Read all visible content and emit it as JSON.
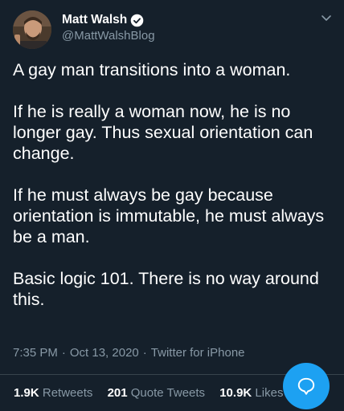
{
  "author": {
    "name": "Matt Walsh",
    "handle": "@MattWalshBlog",
    "verified": true
  },
  "tweet": {
    "paragraphs": [
      "A gay man transitions into a woman.",
      "If he is really a woman now, he is no longer gay. Thus sexual orientation can change.",
      "If he must always be gay because orientation is immutable, he must always be a man.",
      "Basic logic 101. There is no way around this."
    ],
    "time": "7:35 PM",
    "date": "Oct 13, 2020",
    "source": "Twitter for iPhone"
  },
  "stats": {
    "retweets_count": "1.9K",
    "retweets_label": "Retweets",
    "quotes_count": "201",
    "quotes_label": "Quote Tweets",
    "likes_count": "10.9K",
    "likes_label": "Likes"
  },
  "icons": {
    "verified": "verified-badge-icon",
    "more": "chevron-down-icon",
    "compose": "speech-bubble-icon"
  },
  "colors": {
    "background": "#15202b",
    "secondary_text": "#8899a6",
    "accent": "#1da1f2"
  }
}
